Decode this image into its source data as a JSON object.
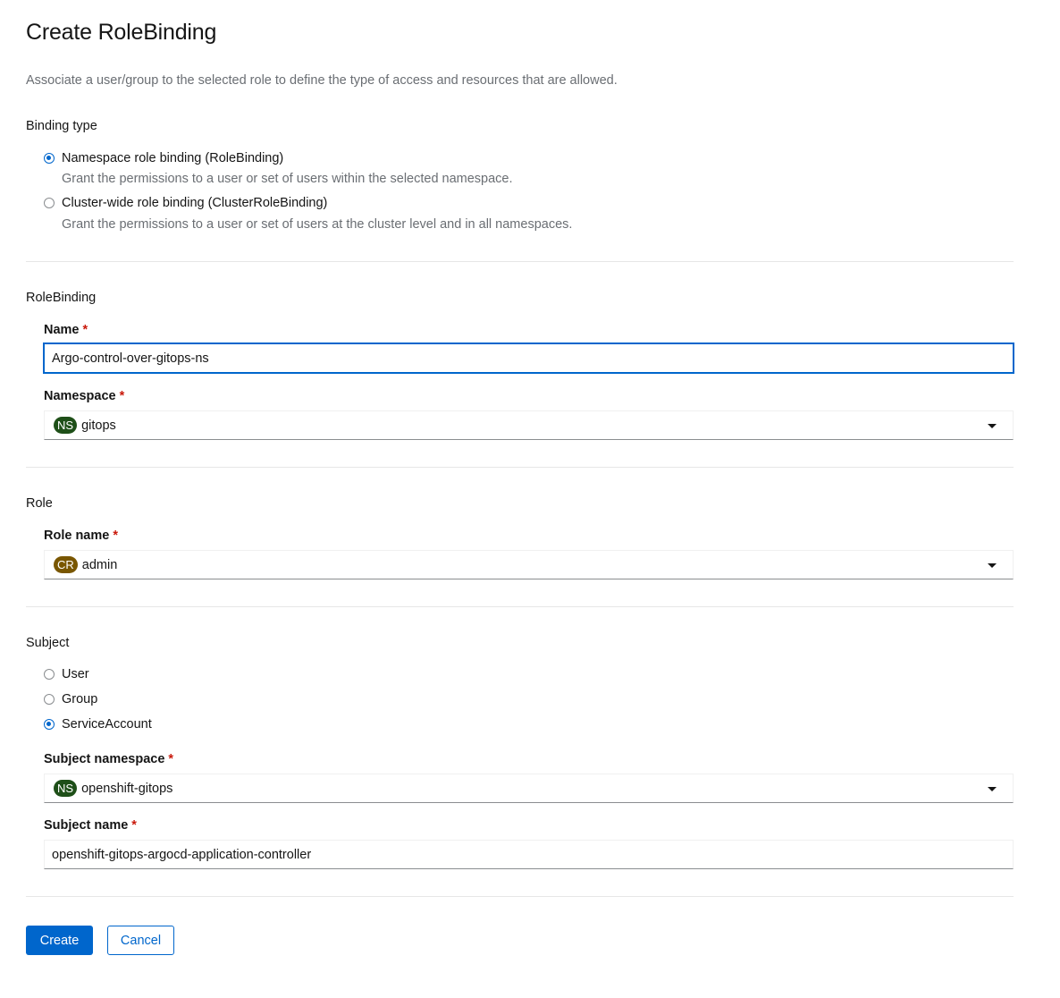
{
  "header": {
    "title": "Create RoleBinding",
    "description": "Associate a user/group to the selected role to define the type of access and resources that are allowed."
  },
  "binding_type": {
    "label": "Binding type",
    "options": [
      {
        "label": "Namespace role binding (RoleBinding)",
        "description": "Grant the permissions to a user or set of users within the selected namespace.",
        "checked": true
      },
      {
        "label": "Cluster-wide role binding (ClusterRoleBinding)",
        "description": "Grant the permissions to a user or set of users at the cluster level and in all namespaces.",
        "checked": false
      }
    ]
  },
  "rolebinding": {
    "label": "RoleBinding",
    "name_label": "Name",
    "name_value": "Argo-control-over-gitops-ns",
    "namespace_label": "Namespace",
    "namespace_badge": "NS",
    "namespace_value": "gitops"
  },
  "role": {
    "label": "Role",
    "role_name_label": "Role name",
    "role_badge": "CR",
    "role_value": "admin"
  },
  "subject": {
    "label": "Subject",
    "options": [
      {
        "label": "User",
        "checked": false
      },
      {
        "label": "Group",
        "checked": false
      },
      {
        "label": "ServiceAccount",
        "checked": true
      }
    ],
    "namespace_label": "Subject namespace",
    "namespace_badge": "NS",
    "namespace_value": "openshift-gitops",
    "name_label": "Subject name",
    "name_value": "openshift-gitops-argocd-application-controller"
  },
  "required_marker": "*",
  "actions": {
    "create_label": "Create",
    "cancel_label": "Cancel"
  },
  "colors": {
    "primary": "#0066cc",
    "ns_badge": "#1e4f18",
    "cr_badge": "#795600",
    "required": "#c9190b"
  }
}
